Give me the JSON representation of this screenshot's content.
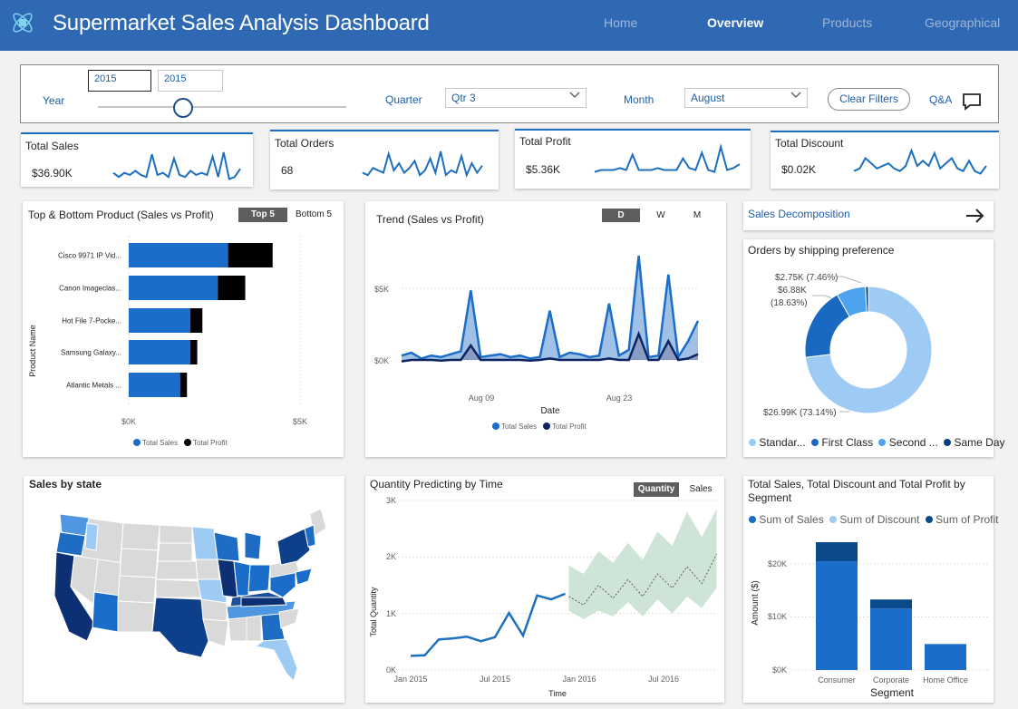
{
  "header": {
    "title": "Supermarket Sales Analysis Dashboard",
    "nav": [
      "Home",
      "Overview",
      "Products",
      "Geographical"
    ],
    "active_nav": "Overview"
  },
  "filters": {
    "year_label": "Year",
    "year_from": "2015",
    "year_to": "2015",
    "quarter_label": "Quarter",
    "quarter_value": "Qtr 3",
    "month_label": "Month",
    "month_value": "August",
    "clear_label": "Clear Filters",
    "qa_label": "Q&A"
  },
  "kpis": [
    {
      "title": "Total Sales",
      "value": "$36.90K",
      "spark": [
        5,
        3,
        5,
        4,
        6,
        4,
        3,
        14,
        4,
        5,
        3,
        12,
        4,
        3,
        6,
        4,
        5,
        4,
        13,
        3,
        15,
        2,
        3,
        7
      ]
    },
    {
      "title": "Total Orders",
      "value": "68",
      "spark": [
        4,
        3,
        6,
        5,
        4,
        12,
        5,
        8,
        4,
        6,
        9,
        3,
        5,
        10,
        4,
        13,
        3,
        5,
        4,
        11,
        3,
        8,
        4,
        7
      ]
    },
    {
      "title": "Total Profit",
      "value": "$5.36K",
      "spark": [
        3,
        4,
        4,
        4,
        5,
        4,
        12,
        4,
        4,
        4,
        5,
        4,
        4,
        4,
        10,
        5,
        4,
        13,
        4,
        3,
        16,
        4,
        5,
        7
      ]
    },
    {
      "title": "Total Discount",
      "value": "$0.02K",
      "spark": [
        4,
        5,
        9,
        7,
        5,
        6,
        7,
        5,
        4,
        6,
        12,
        6,
        8,
        6,
        11,
        5,
        7,
        9,
        5,
        4,
        8,
        4,
        3,
        6
      ]
    }
  ],
  "top_bottom": {
    "title": "Top & Bottom Product (Sales vs Profit)",
    "toggle": [
      "Top 5",
      "Bottom 5"
    ],
    "ylabel": "Product Name",
    "ticks": [
      "$0K",
      "$5K"
    ],
    "legend": [
      "Total Sales",
      "Total Profit"
    ]
  },
  "trend": {
    "title": "Trend (Sales vs Profit)",
    "toggle": [
      "D",
      "W",
      "M"
    ],
    "xlabel": "Date",
    "yticks": [
      "$5K",
      "$0K"
    ],
    "xticks": [
      "Aug 09",
      "Aug 23"
    ],
    "legend": [
      "Total Sales",
      "Total Profit"
    ]
  },
  "decomp": {
    "label": "Sales Decomposition"
  },
  "shipping": {
    "title": "Orders by shipping preference",
    "labels": [
      "$2.75K (7.46%)",
      "$6.88K",
      "(18.63%)",
      "$26.99K (73.14%)"
    ],
    "legend": [
      "Standar...",
      "First Class",
      "Second ...",
      "Same Day"
    ]
  },
  "state": {
    "title": "Sales by state"
  },
  "forecast": {
    "title": "Quantity Predicting by Time",
    "toggle": [
      "Quantity",
      "Sales"
    ],
    "ylabel": "Total Quantity",
    "xlabel": "Time",
    "yticks": [
      "3K",
      "2K",
      "1K",
      "0K"
    ],
    "xticks": [
      "Jan 2015",
      "Jul 2015",
      "Jan 2016",
      "Jul 2016"
    ]
  },
  "segment": {
    "title_line1": "Total Sales, Total Discount and Total Profit by",
    "title_line2": "Segment",
    "legend": [
      "Sum of Sales",
      "Sum of Discount",
      "Sum of Profit"
    ],
    "ylabel": "Amount ($)",
    "xlabel": "Segment",
    "yticks": [
      "$20K",
      "$10K",
      "$0K"
    ]
  },
  "chart_data": [
    {
      "type": "bar",
      "title": "Top & Bottom Product (Sales vs Profit)",
      "orientation": "horizontal",
      "stacked": true,
      "categories": [
        "Cisco 9971 IP Vid...",
        "Canon Imageclas...",
        "Hot File 7-Pocke...",
        "Samsung Galaxy...",
        "Atlantic Metals ..."
      ],
      "series": [
        {
          "name": "Total Sales",
          "values": [
            2.9,
            2.6,
            1.8,
            1.8,
            1.5
          ],
          "color": "#1a6dc8"
        },
        {
          "name": "Total Profit",
          "values": [
            1.3,
            0.8,
            0.35,
            0.2,
            0.2
          ],
          "color": "#000000"
        }
      ],
      "xlim": [
        0,
        5.4
      ],
      "unit": "$K"
    },
    {
      "type": "area",
      "title": "Trend (Sales vs Profit)",
      "xlabel": "Date",
      "x_labels": {
        "Aug 09": 7,
        "Aug 23": 21
      },
      "series": [
        {
          "name": "Total Sales",
          "values": [
            0.3,
            0.5,
            0.1,
            0.3,
            0.2,
            0.4,
            0.6,
            4.8,
            0.2,
            0.3,
            0.4,
            0.2,
            0.3,
            0.1,
            0.2,
            3.4,
            0.2,
            0.5,
            0.4,
            0.2,
            0.3,
            3.9,
            0.3,
            0.7,
            7.2,
            0.2,
            0.3,
            5.9,
            0.2,
            1.3,
            2.7
          ],
          "color": "#1a6dc8"
        },
        {
          "name": "Total Profit",
          "values": [
            -0.1,
            0.0,
            0.0,
            0.0,
            -0.05,
            0.0,
            0.0,
            1.0,
            0.0,
            0.0,
            0.0,
            0.0,
            0.0,
            -0.05,
            0.0,
            0.1,
            0.0,
            0.0,
            0.0,
            0.0,
            0.0,
            0.1,
            0.0,
            0.0,
            1.8,
            0.0,
            0.0,
            1.3,
            0.0,
            0.1,
            0.4
          ],
          "color": "#0c2461"
        }
      ],
      "ylim": [
        -0.3,
        7.8
      ],
      "unit": "$K"
    },
    {
      "type": "pie",
      "title": "Orders by shipping preference",
      "donut": true,
      "labels": [
        "Standard Class",
        "First Class",
        "Second Class",
        "Same Day"
      ],
      "values": [
        26.99,
        6.88,
        2.75,
        0.28
      ],
      "colors": [
        "#9ecbf4",
        "#1968c2",
        "#4da3ee",
        "#0a3f7a"
      ]
    },
    {
      "type": "line",
      "title": "Quantity Predicting by Time",
      "xlabel": "Time",
      "ylabel": "Total Quantity",
      "x": [
        "2015-01",
        "2015-02",
        "2015-03",
        "2015-04",
        "2015-05",
        "2015-06",
        "2015-07",
        "2015-08",
        "2015-09",
        "2015-10",
        "2015-11",
        "2015-12"
      ],
      "values": [
        250,
        260,
        540,
        560,
        590,
        510,
        580,
        1010,
        610,
        1320,
        1250,
        1350
      ],
      "forecast": {
        "x": [
          "2016-01",
          "2016-02",
          "2016-03",
          "2016-04",
          "2016-05",
          "2016-06",
          "2016-07",
          "2016-08",
          "2016-09",
          "2016-10",
          "2016-11"
        ],
        "mean": [
          1300,
          1150,
          1500,
          1270,
          1600,
          1300,
          1700,
          1450,
          1830,
          1530,
          2050
        ],
        "upper": [
          1850,
          1700,
          2100,
          1900,
          2250,
          1950,
          2450,
          2200,
          2800,
          2350,
          2850
        ],
        "lower": [
          1050,
          900,
          1050,
          950,
          1200,
          950,
          1250,
          1000,
          1300,
          1100,
          1450
        ]
      },
      "ylim": [
        0,
        3000
      ]
    },
    {
      "type": "bar",
      "title": "Total Sales, Total Discount and Total Profit by Segment",
      "stacked": true,
      "categories": [
        "Consumer",
        "Corporate",
        "Home Office"
      ],
      "series": [
        {
          "name": "Sum of Sales",
          "values": [
            20500,
            11600,
            4900
          ],
          "color": "#1a6dc8"
        },
        {
          "name": "Sum of Discount",
          "values": [
            0,
            0,
            0
          ],
          "color": "#9ecbf4"
        },
        {
          "name": "Sum of Profit",
          "values": [
            3600,
            1700,
            0
          ],
          "color": "#0a4a8a"
        }
      ],
      "ylim": [
        0,
        26000
      ],
      "ylabel": "Amount ($)",
      "xlabel": "Segment"
    }
  ]
}
